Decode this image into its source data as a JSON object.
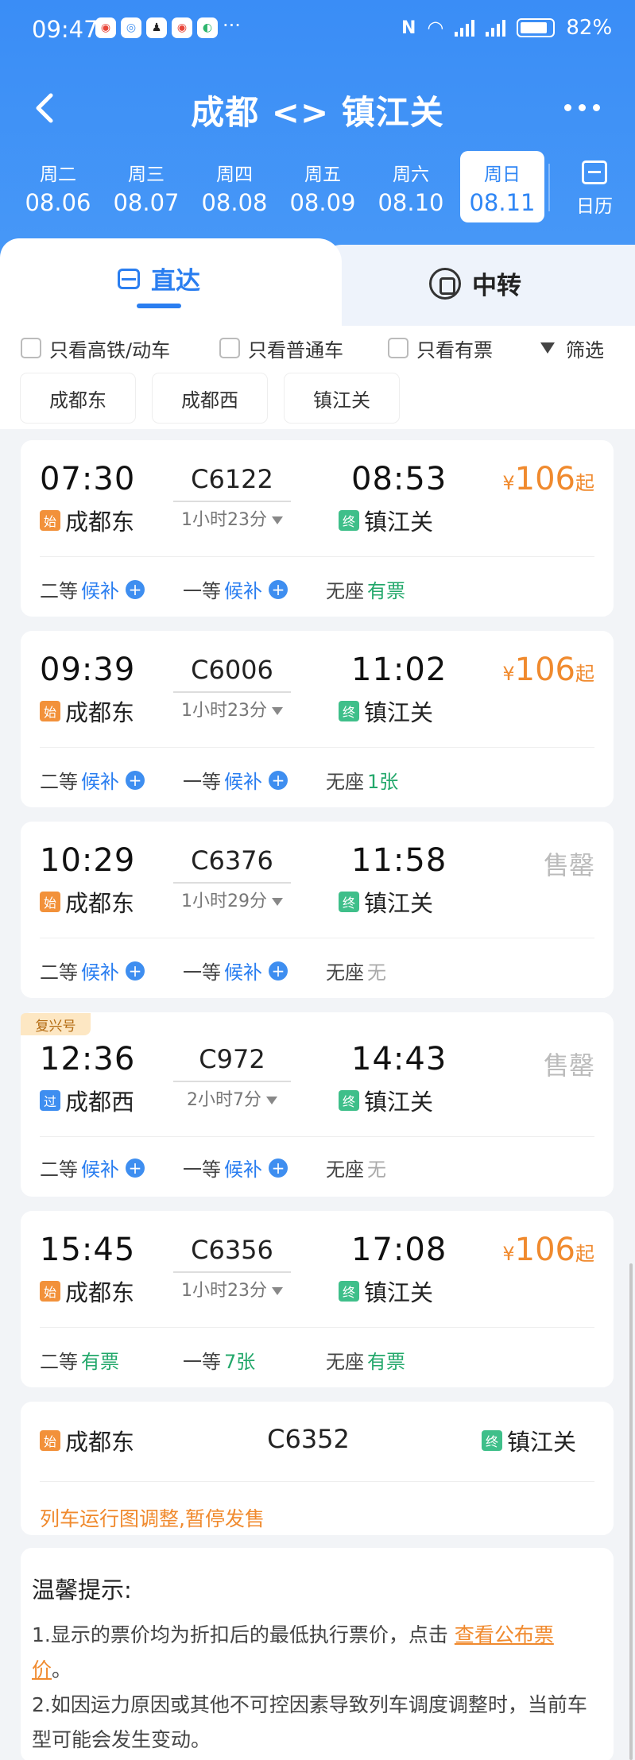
{
  "status": {
    "time": "09:47",
    "battery": "82%",
    "more": "···"
  },
  "nav": {
    "title": "成都 <> 镇江关"
  },
  "days": [
    {
      "week": "周二",
      "date": "08.06"
    },
    {
      "week": "周三",
      "date": "08.07"
    },
    {
      "week": "周四",
      "date": "08.08"
    },
    {
      "week": "周五",
      "date": "08.09"
    },
    {
      "week": "周六",
      "date": "08.10"
    },
    {
      "week": "周日",
      "date": "08.11"
    }
  ],
  "calendar_label": "日历",
  "tabs": {
    "direct": "直达",
    "transfer": "中转"
  },
  "filters": {
    "high_speed": "只看高铁/动车",
    "normal": "只看普通车",
    "available": "只看有票",
    "filter": "筛选"
  },
  "stations": [
    "成都东",
    "成都西",
    "镇江关"
  ],
  "trains": [
    {
      "dep": "07:30",
      "arr": "08:53",
      "code": "C6122",
      "dur": "1小时23分",
      "from": "成都东",
      "from_tag": "始",
      "to": "镇江关",
      "to_tag": "终",
      "price": "106",
      "yen": "¥",
      "qi": "起",
      "seats": [
        {
          "cls": "二等",
          "st": "候补"
        },
        {
          "cls": "一等",
          "st": "候补"
        },
        {
          "cls": "无座",
          "st": "有票"
        }
      ]
    },
    {
      "dep": "09:39",
      "arr": "11:02",
      "code": "C6006",
      "dur": "1小时23分",
      "from": "成都东",
      "from_tag": "始",
      "to": "镇江关",
      "to_tag": "终",
      "price": "106",
      "yen": "¥",
      "qi": "起",
      "seats": [
        {
          "cls": "二等",
          "st": "候补"
        },
        {
          "cls": "一等",
          "st": "候补"
        },
        {
          "cls": "无座",
          "st": "1张"
        }
      ]
    },
    {
      "dep": "10:29",
      "arr": "11:58",
      "code": "C6376",
      "dur": "1小时29分",
      "from": "成都东",
      "from_tag": "始",
      "to": "镇江关",
      "to_tag": "终",
      "sold": "售罄",
      "seats": [
        {
          "cls": "二等",
          "st": "候补"
        },
        {
          "cls": "一等",
          "st": "候补"
        },
        {
          "cls": "无座",
          "st": "无"
        }
      ]
    },
    {
      "badge": "复兴号",
      "dep": "12:36",
      "arr": "14:43",
      "code": "C972",
      "dur": "2小时7分",
      "from": "成都西",
      "from_tag": "过",
      "to": "镇江关",
      "to_tag": "终",
      "sold": "售罄",
      "seats": [
        {
          "cls": "二等",
          "st": "候补"
        },
        {
          "cls": "一等",
          "st": "候补"
        },
        {
          "cls": "无座",
          "st": "无"
        }
      ]
    },
    {
      "dep": "15:45",
      "arr": "17:08",
      "code": "C6356",
      "dur": "1小时23分",
      "from": "成都东",
      "from_tag": "始",
      "to": "镇江关",
      "to_tag": "终",
      "price": "106",
      "yen": "¥",
      "qi": "起",
      "seats": [
        {
          "cls": "二等",
          "st": "有票"
        },
        {
          "cls": "一等",
          "st": "7张"
        },
        {
          "cls": "无座",
          "st": "有票"
        }
      ]
    }
  ],
  "suspended": {
    "code": "C6352",
    "from": "成都东",
    "from_tag": "始",
    "to": "镇江关",
    "to_tag": "终",
    "msg": "列车运行图调整,暂停发售"
  },
  "tips": {
    "title": "温馨提示:",
    "l1a": "1.显示的票价均为折扣后的最低执行票价，点击 ",
    "l1link": "查看公布票价",
    "l1b": "。",
    "l2": "2.如因运力原因或其他不可控因素导致列车调度调整时，当前车型可能会发生变动。"
  },
  "colors": {
    "header": "#3a8df6",
    "accent": "#2a7ef0",
    "price": "#f08a2e",
    "available": "#23a86b"
  }
}
